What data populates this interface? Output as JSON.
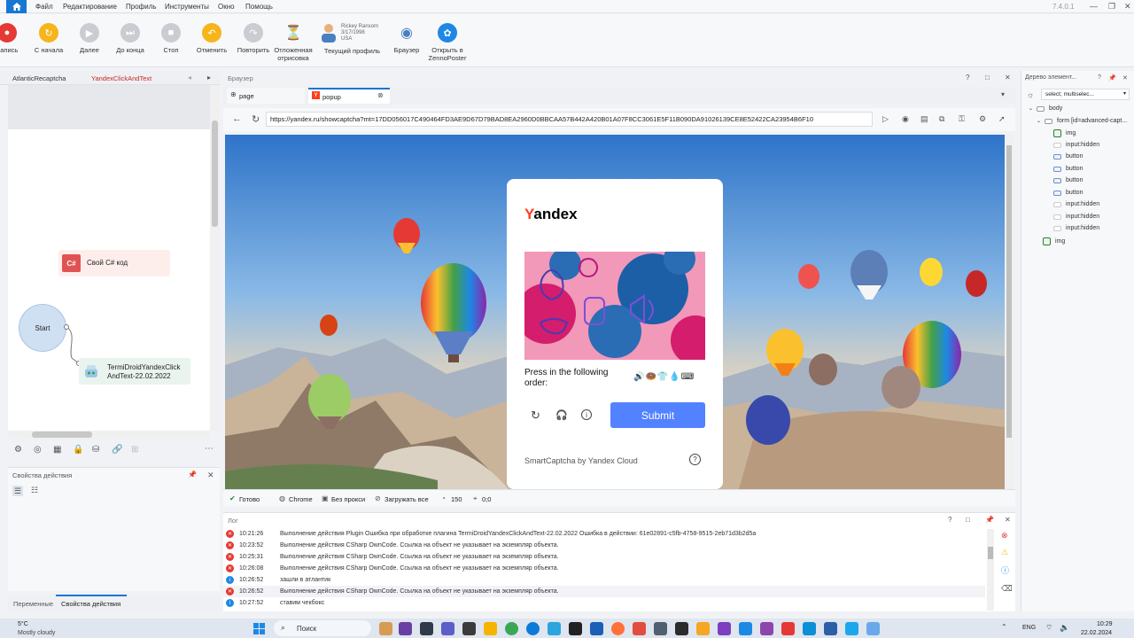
{
  "menubar": {
    "items": [
      "Файл",
      "Редактирование",
      "Профиль",
      "Инструменты",
      "Окно",
      "Помощь"
    ],
    "version": "7.4.0.1"
  },
  "toolbar": {
    "buttons": [
      {
        "label": "Запись",
        "icon": "record-icon",
        "color": "#e53935"
      },
      {
        "label": "С начала",
        "icon": "restart-icon",
        "color": "#f5b51b"
      },
      {
        "label": "Далее",
        "icon": "next-icon",
        "color": "#c9ccd1"
      },
      {
        "label": "До конца",
        "icon": "to-end-icon",
        "color": "#c9ccd1"
      },
      {
        "label": "Стоп",
        "icon": "stop-icon",
        "color": "#c9ccd1"
      },
      {
        "label": "Отменить",
        "icon": "undo-icon",
        "color": "#f5b51b"
      },
      {
        "label": "Повторить",
        "icon": "redo-icon",
        "color": "#c9ccd1"
      },
      {
        "label": "Отложенная отрисовка",
        "icon": "hourglass-icon",
        "color": "#8a6d3b"
      },
      {
        "label": "Текущий профиль",
        "icon": "profile-icon",
        "color": "#4a7fc1"
      },
      {
        "label": "Браузер",
        "icon": "eye-icon",
        "color": "#4a7fc1"
      },
      {
        "label": "Открыть в ZennoPoster",
        "icon": "zennoposter-icon",
        "color": "#1e88e5"
      }
    ],
    "profile": {
      "name": "Rickey Ransom",
      "dob": "3/17/1998",
      "country": "USA"
    }
  },
  "left": {
    "tabs": [
      "AtlanticRecaptcha",
      "YandexClickAndText"
    ],
    "nodes": {
      "csharp_badge": "C#",
      "csharp_label": "Свой C# код",
      "start": "Start",
      "termi_line1": "TermiDroidYandexClick",
      "termi_line2": "AndText-22.02.2022"
    },
    "props_title": "Свойства действия",
    "bottom_tabs": [
      "Переменные",
      "Свойства действия"
    ]
  },
  "browser": {
    "title": "Браузер",
    "tabs": [
      "page",
      "popup"
    ],
    "url": "https://yandex.ru/showcaptcha?mt=17DD056017C490464FD3AE9D67D79BAD8EA2960D0BBCAA57B442A420B01A07F8CC3061E5F11B090DA91026139CE8E52422CA23954B6F10",
    "status": [
      "Готово",
      "Chrome",
      "Без прокси",
      "Загружать все",
      "150",
      "0;0"
    ]
  },
  "captcha": {
    "brand_first": "Y",
    "brand_rest": "andex",
    "instruction": "Press in the following order:",
    "sequence": "🔊🍩👕💧⌨",
    "submit": "Submit",
    "footer": "SmartCaptcha by Yandex Cloud"
  },
  "tree": {
    "title": "Дерево элемент...",
    "selector": "select; multiselec...",
    "rows": [
      "body",
      "form [id=advanced-capt...",
      "img",
      "input:hidden",
      "button",
      "button",
      "button",
      "button",
      "input:hidden",
      "input:hidden",
      "input:hidden",
      "img"
    ]
  },
  "log": {
    "title": "Лог",
    "rows": [
      {
        "time": "10:21:26",
        "type": "error",
        "text": "Выполнение действия Plugin Ошибка при обработке плагина TermiDroidYandexClickAndText-22.02.2022 Ошибка в действии: 61e02891-c5fb-4758-9515-2eb71d3b2d5a"
      },
      {
        "time": "10:23:52",
        "type": "error",
        "text": "Выполнение действия CSharp OwnCode. Ссылка на объект не указывает на экземпляр объекта."
      },
      {
        "time": "10:25:31",
        "type": "error",
        "text": "Выполнение действия CSharp OwnCode. Ссылка на объект не указывает на экземпляр объекта."
      },
      {
        "time": "10:26:08",
        "type": "error",
        "text": "Выполнение действия CSharp OwnCode. Ссылка на объект не указывает на экземпляр объекта."
      },
      {
        "time": "10:26:52",
        "type": "info",
        "text": "зашли в атлантик"
      },
      {
        "time": "10:26:52",
        "type": "error",
        "text": "Выполнение действия CSharp OwnCode. Ссылка на объект не указывает на экземпляр объекта."
      },
      {
        "time": "10:27:52",
        "type": "info",
        "text": "ставим чекбокс"
      }
    ]
  },
  "taskbar": {
    "weather_temp": "5°C",
    "weather_desc": "Mostly cloudy",
    "search": "Поиск",
    "lang": "ENG",
    "time": "10:29",
    "date": "22.02.2024"
  },
  "colors": {
    "accent": "#1976d2",
    "submit": "#5282ff",
    "error": "#e53935",
    "info": "#1e88e5",
    "tab_active": "#c62828"
  }
}
